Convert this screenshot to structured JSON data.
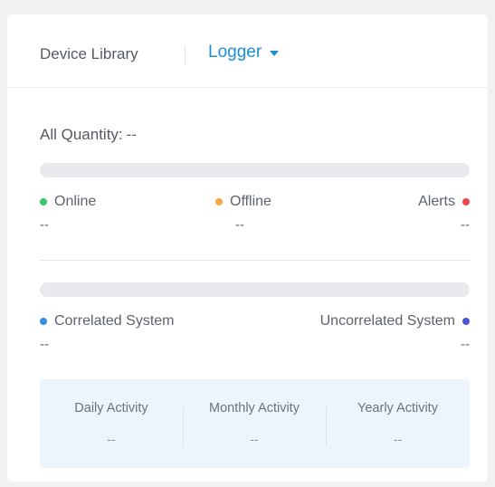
{
  "header": {
    "title": "Device Library",
    "dropdown_label": "Logger"
  },
  "all_quantity": {
    "label": "All Quantity:",
    "value": "--"
  },
  "status": {
    "online": {
      "label": "Online",
      "value": "--",
      "color": "#3ec46d"
    },
    "offline": {
      "label": "Offline",
      "value": "--",
      "color": "#f5a742"
    },
    "alerts": {
      "label": "Alerts",
      "value": "--",
      "color": "#f0464b"
    }
  },
  "correlation": {
    "correlated": {
      "label": "Correlated System",
      "value": "--",
      "color": "#2f8fe0"
    },
    "uncorrelated": {
      "label": "Uncorrelated System",
      "value": "--",
      "color": "#4b55d8"
    }
  },
  "activity": [
    {
      "label": "Daily Activity",
      "value": "--"
    },
    {
      "label": "Monthly Activity",
      "value": "--"
    },
    {
      "label": "Yearly Activity",
      "value": "--"
    }
  ]
}
